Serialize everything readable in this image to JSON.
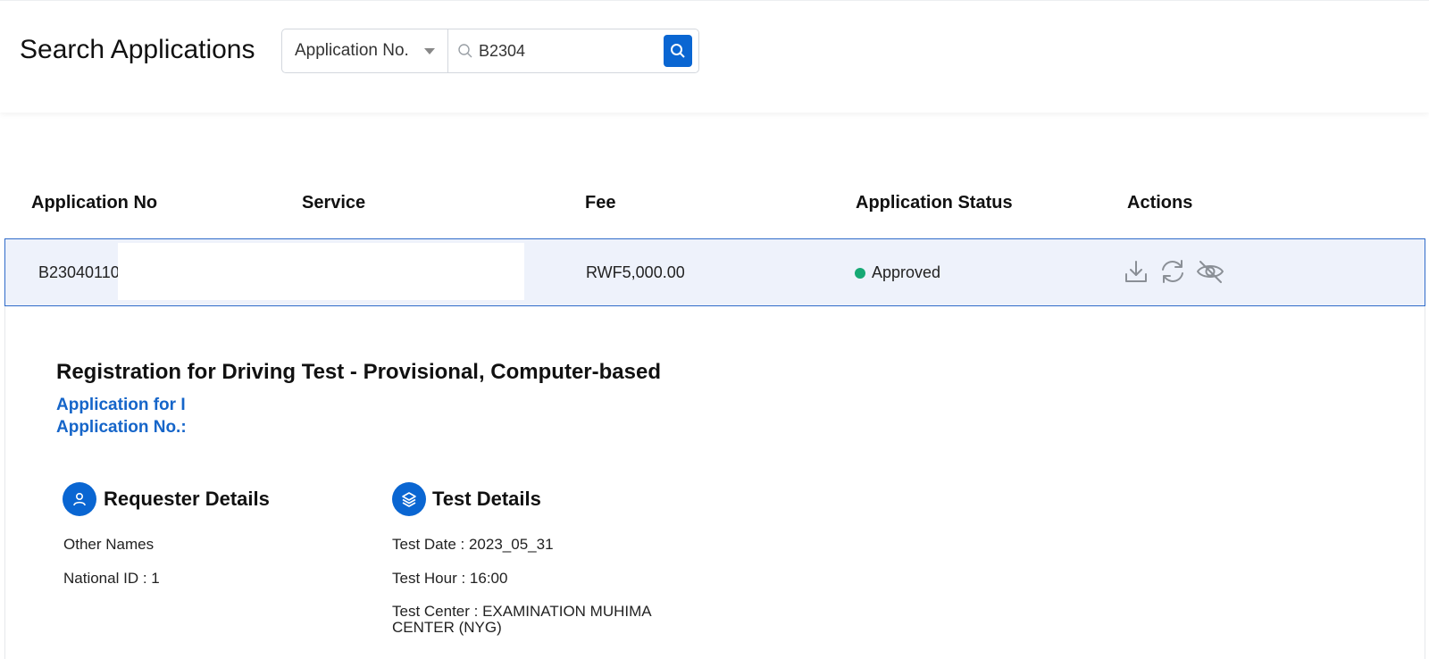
{
  "header": {
    "title": "Search Applications",
    "search": {
      "type_selected": "Application No.",
      "query": "B2304",
      "button_icon": "search-icon"
    }
  },
  "table": {
    "columns": [
      "Application No",
      "Service",
      "Fee",
      "Application Status",
      "Actions"
    ],
    "row": {
      "application_no": "B23040110",
      "fee": "RWF5,000.00",
      "status": "Approved",
      "status_color": "#16a974",
      "actions": [
        "download-icon",
        "refresh-icon",
        "eye-off-icon"
      ]
    }
  },
  "details": {
    "service_title": "Registration for Driving Test - Provisional, Computer-based",
    "application_for": "Application for I",
    "application_no_label": "Application No.:",
    "requester": {
      "title": "Requester Details",
      "other_names": "Other Names",
      "national_id": "National ID : 1"
    },
    "test": {
      "title": "Test Details",
      "date": "Test Date : 2023_05_31",
      "hour": "Test Hour : 16:00",
      "center": "Test Center : EXAMINATION MUHIMA CENTER (NYG)"
    }
  },
  "colors": {
    "accent": "#0a66d2",
    "link": "#1565c9",
    "row_highlight": "#eef2fb",
    "row_border": "#2f6bc9"
  }
}
